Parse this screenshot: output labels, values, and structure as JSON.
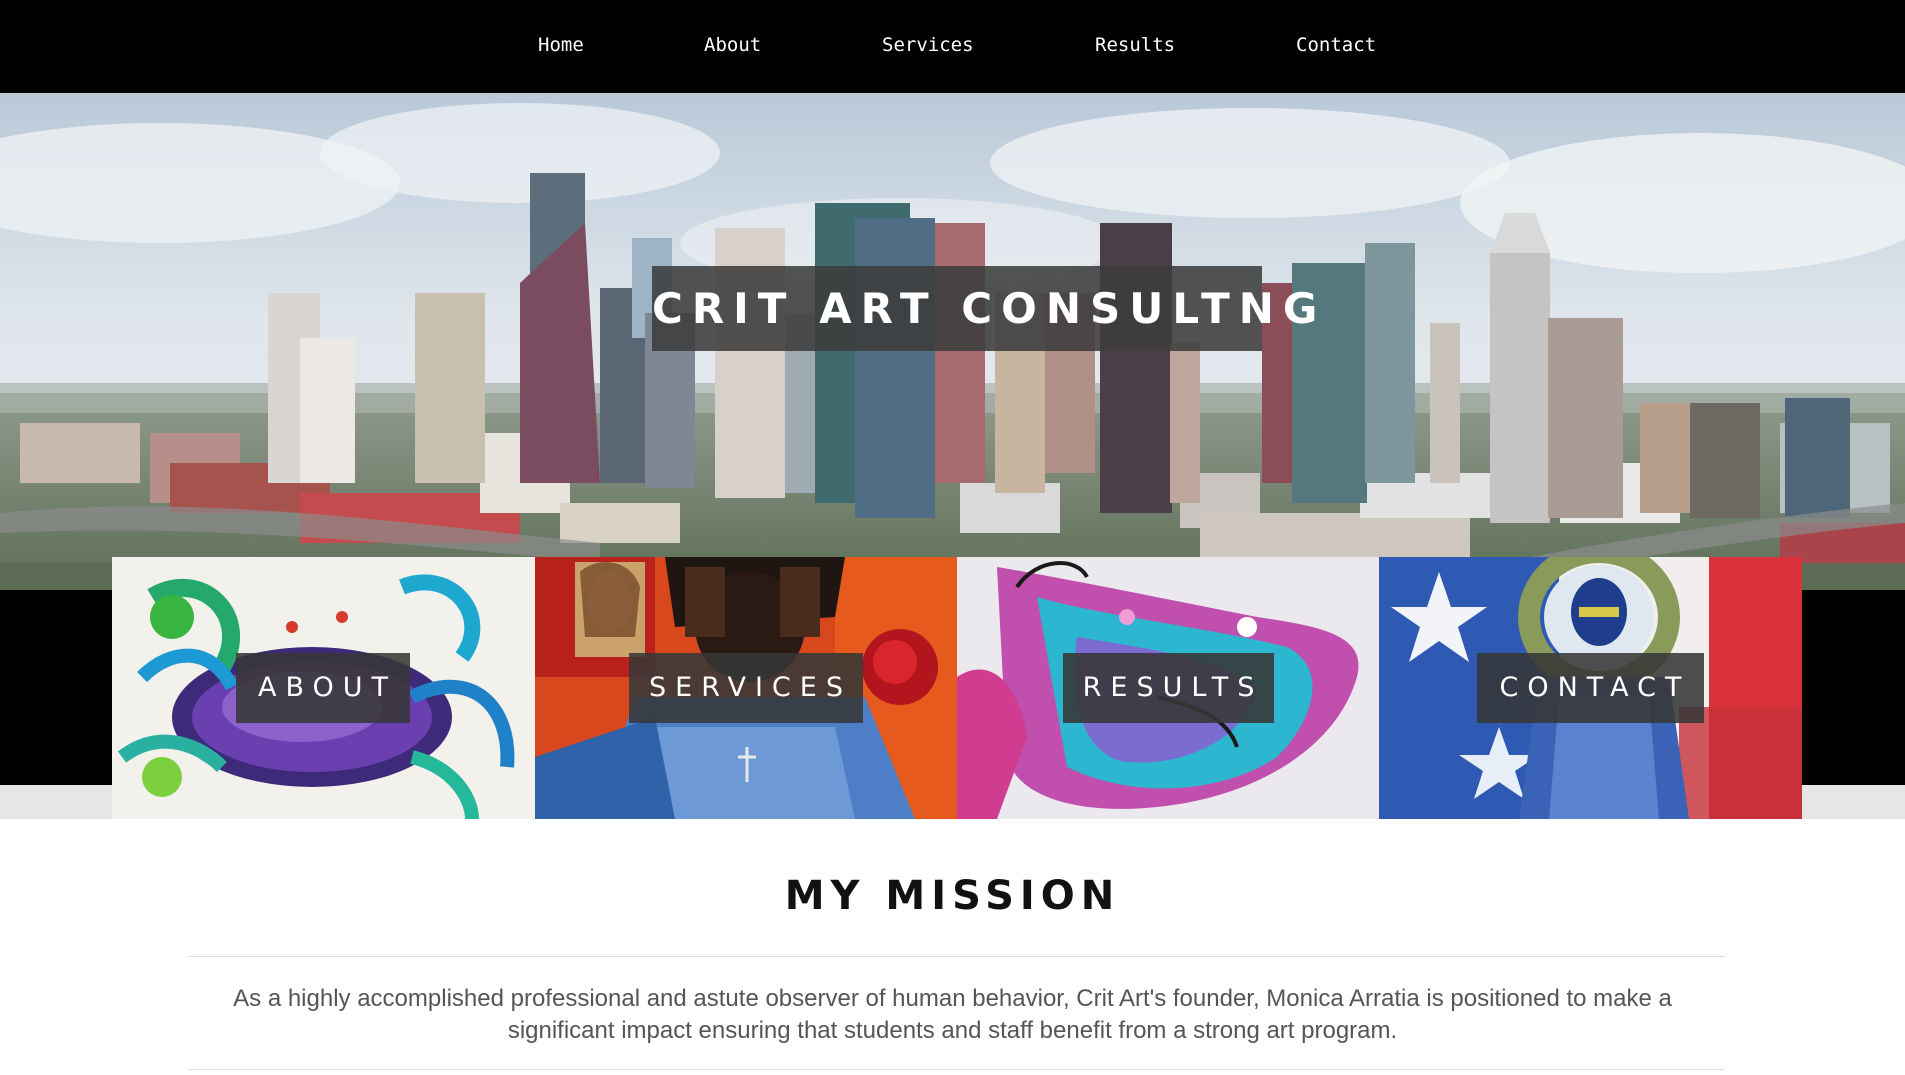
{
  "nav": {
    "items": [
      {
        "label": "Home"
      },
      {
        "label": "About"
      },
      {
        "label": "Services"
      },
      {
        "label": "Results"
      },
      {
        "label": "Contact"
      }
    ]
  },
  "hero": {
    "title": "CRIT ART CONSULTNG",
    "image": "houston-skyline-photo"
  },
  "tiles": [
    {
      "label": "ABOUT",
      "image": "blue-crab-painting"
    },
    {
      "label": "SERVICES",
      "image": "praying-figure-painting"
    },
    {
      "label": "RESULTS",
      "image": "abstract-bull-painting"
    },
    {
      "label": "CONTACT",
      "image": "texas-flag-figure-painting"
    }
  ],
  "mission": {
    "title": "MY MISSION",
    "text": "As a highly accomplished professional and astute observer of human behavior, Crit Art's founder, Monica Arratia is positioned to make a significant impact ensuring that students and staff benefit from a strong art program."
  },
  "colors": {
    "nav_bg": "#000000",
    "overlay_bg": "#3c3c3c",
    "body_text": "#555555"
  }
}
